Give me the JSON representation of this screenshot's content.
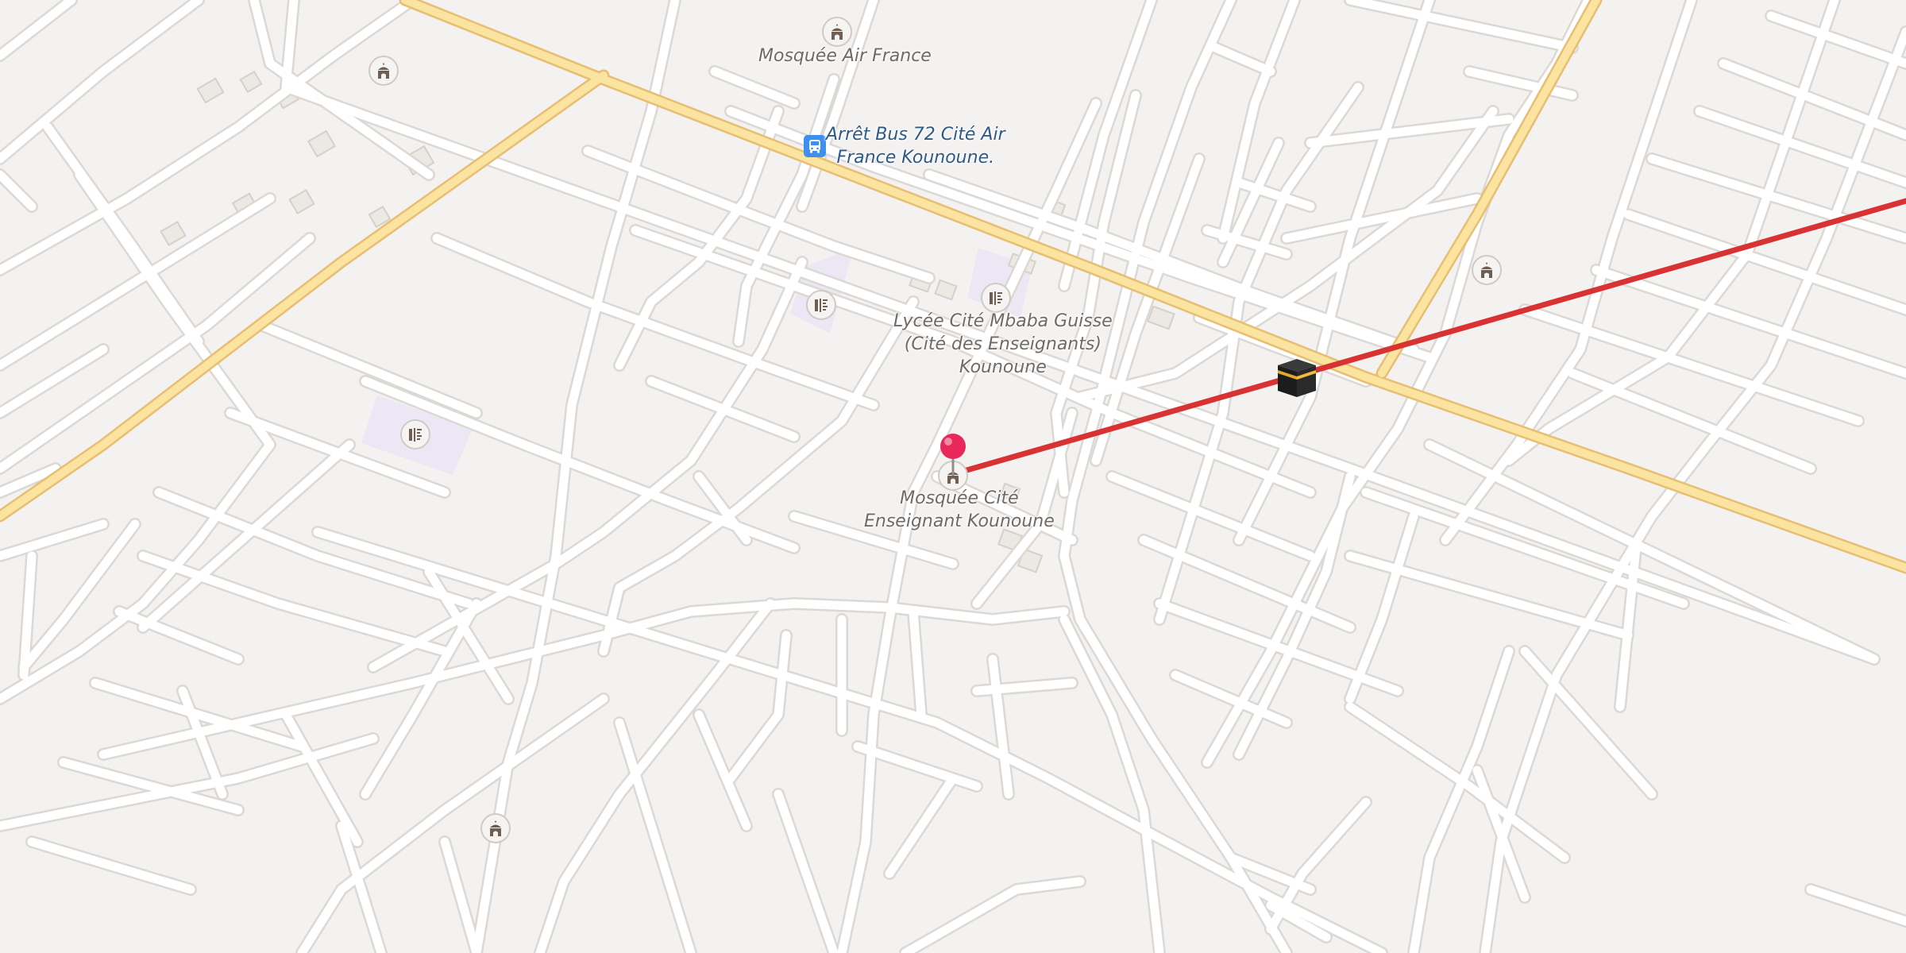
{
  "map": {
    "places": {
      "mosque_air_france": "Mosquée Air France",
      "bus_stop_line1": "Arrêt Bus 72 Cité Air",
      "bus_stop_line2": "France Kounoune.",
      "lycee_line1": "Lycée Cité Mbaba Guisse",
      "lycee_line2": "(Cité des Enseignants)",
      "lycee_line3": "Kounoune",
      "mosque_cite_line1": "Mosquée Cité",
      "mosque_cite_line2": "Enseignant Kounoune"
    },
    "icons": {
      "mosque": "mosque-icon",
      "school": "school-icon",
      "bus": "bus-stop-icon",
      "pin": "location-pin-icon",
      "kaaba": "kaaba-icon"
    },
    "colors": {
      "background": "#f4f2f0",
      "street": "#ffffff",
      "street_casing": "#dcd8d4",
      "major_road": "#fbe3a0",
      "major_road_casing": "#e8bd74",
      "qibla_line": "#d93232",
      "school_area": "#ebe7f4",
      "pin": "#e8285a"
    }
  }
}
